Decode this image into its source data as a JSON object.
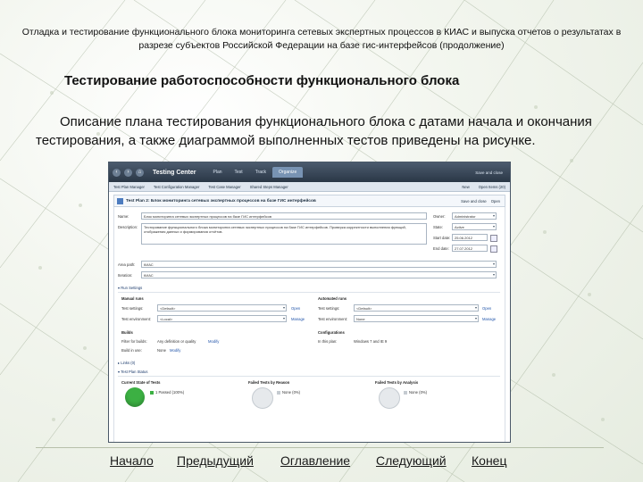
{
  "slide": {
    "header": "Отладка и тестирование функционального блока мониторинга сетевых экспертных процессов в КИАС и выпуска отчетов о результатах в разрезе субъектов Российской Федерации на базе гис-интерфейсов (продолжение)",
    "subtitle": "Тестирование работоспособности функционального блока",
    "body": "Описание плана тестирования функционального блока с датами начала и окончания тестирования, а также диаграммой выполненных тестов приведены на рисунке."
  },
  "screenshot": {
    "app_title": "Testing Center",
    "hub_tabs": [
      "Plan",
      "Test",
      "Track",
      "Organize"
    ],
    "title_links": [
      "Save and close"
    ],
    "subnav_items": [
      "Test Plan Manager",
      "Test Configuration Manager",
      "Test Case Manager",
      "Shared Steps Manager"
    ],
    "subnav_right": [
      "New",
      "Open Items (20)"
    ],
    "plan_title": "Test Plan 2: Блок мониторинга сетевых экспертных процессов на базе ГИС интерфейсов",
    "head_actions": [
      "Save and close",
      "Open"
    ],
    "form": {
      "name_label": "Name:",
      "name_value": "Блок мониторинга сетевых экспертных процессов на базе ГИС интерфейсов",
      "description_label": "Description:",
      "description_value": "Тестирование функционального блока мониторинга сетевых экспертных процессов на базе ГИС интерфейсов. Проверка корректности выполнения функций, отображения данных и формирования отчётов.",
      "owner_label": "Owner:",
      "owner_value": "Administrator",
      "state_label": "State:",
      "state_value": "Active",
      "start_label": "Start date:",
      "start_value": "25.06.2012",
      "end_label": "End date:",
      "end_value": "27.07.2012",
      "area_label": "Area path:",
      "area_value": "КИАС",
      "iteration_label": "Iteration:",
      "iteration_value": "КИАС",
      "run_settings": "Run Settings",
      "manual_runs": "Manual runs",
      "automated_runs": "Automated runs",
      "test_settings_label": "Test settings:",
      "manual_test_settings": "<Default>",
      "auto_test_settings": "<Default>",
      "test_env_label": "Test environment:",
      "manual_env": "<Local>",
      "auto_env": "None",
      "open": "Open",
      "manage": "Manage",
      "builds": "Builds",
      "filter_label": "Filter for builds:",
      "filter_value": "Any definition or quality",
      "modify": "Modify",
      "build_in_use_label": "Build in use:",
      "build_in_use_value": "None",
      "configurations": "Configurations",
      "in_this_plan_label": "In this plan:",
      "in_this_plan_value": "Windows 7 and IE 9",
      "links": "Links (0)",
      "test_plan_status": "Test Plan Status",
      "current_state_title": "Current State of Tests",
      "current_state_legend": "1 Passed (100%)",
      "failed_reason_title": "Failed Tests by Reason",
      "failed_reason_legend": "None (0%)",
      "failed_analysis_title": "Failed Tests by Analysis",
      "failed_analysis_legend": "None (0%)"
    },
    "colors": {
      "passed": "#3cb043",
      "none": "#e6e9ec"
    }
  },
  "footer_nav": [
    "Начало",
    "Предыдущий",
    "Оглавление",
    "Следующий",
    "Конец"
  ]
}
